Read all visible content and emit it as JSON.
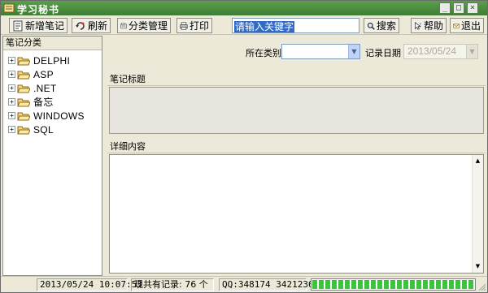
{
  "window": {
    "title": "学习秘书"
  },
  "toolbar": {
    "add_label": "新增笔记",
    "refresh_label": "刷新",
    "category_label": "分类管理",
    "print_label": "打印",
    "search_value": "请输入关键字",
    "search_button_label": "搜索",
    "help_label": "帮助",
    "exit_label": "退出"
  },
  "sidebar": {
    "title": "笔记分类",
    "items": [
      {
        "label": "DELPHI"
      },
      {
        "label": "ASP"
      },
      {
        "label": ".NET"
      },
      {
        "label": "备忘"
      },
      {
        "label": "WINDOWS"
      },
      {
        "label": "SQL"
      }
    ]
  },
  "filters": {
    "category_label": "所在类别",
    "category_value": "",
    "date_label": "记录日期",
    "date_value": "2013/05/24"
  },
  "note": {
    "title_label": "笔记标题",
    "detail_label": "详细内容"
  },
  "status": {
    "datetime": "2013/05/24 10:07:53",
    "record_count": "现共有记录: 76 个",
    "qq": "QQ:348174  3421236",
    "progress": 1.0
  },
  "colors": {
    "titlebar": "#4a8c3f",
    "progress": "#39c439",
    "selection": "#316ac5"
  },
  "icons": {
    "add": "notebook-icon",
    "refresh": "refresh-icon",
    "category": "category-icon",
    "print": "printer-icon",
    "search": "magnifier-icon",
    "help": "help-icon",
    "exit": "exit-icon",
    "folder": "folder-icon"
  }
}
